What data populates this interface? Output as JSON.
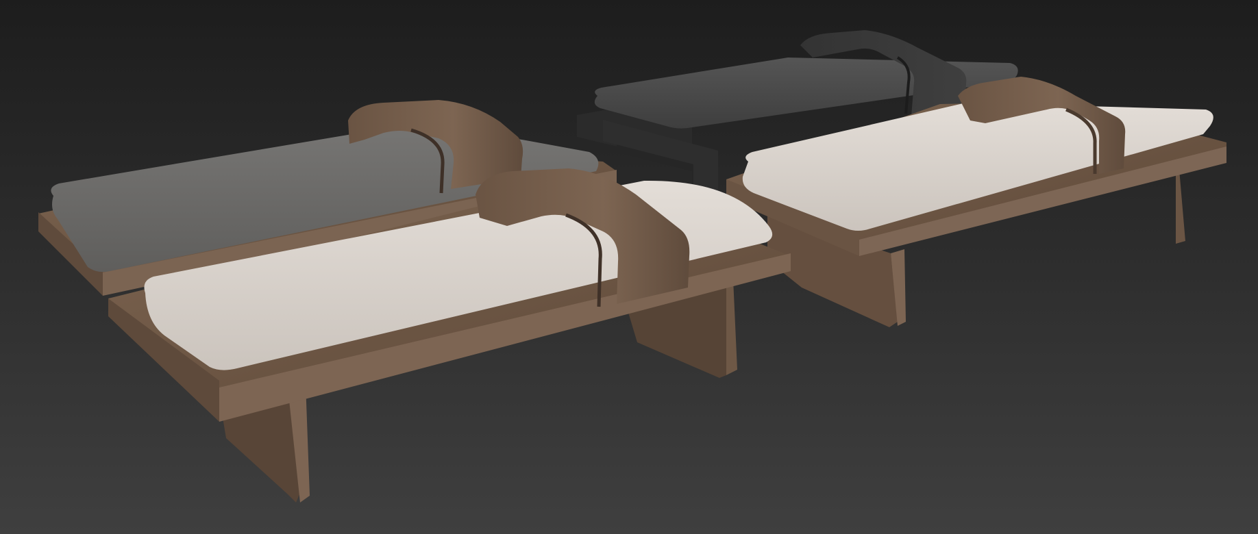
{
  "scene": {
    "subject": "render",
    "background": {
      "top": "#1d1d1d",
      "bottom": "#3f3f3f"
    },
    "benches": [
      {
        "id": "grey-cushion-bench",
        "cushion_color": "#6c6b69",
        "frame_color": "#6b5543",
        "band_color": "#6d5644"
      },
      {
        "id": "light-cushion-bench-front",
        "cushion_color": "#d7d1cb",
        "frame_color": "#6a5444",
        "band_color": "#705847"
      },
      {
        "id": "dark-cushion-bench",
        "cushion_color": "#4a4a4a",
        "frame_color": "#2a2a2a",
        "band_color": "#3a3a3a"
      },
      {
        "id": "light-cushion-bench-right",
        "cushion_color": "#d8d3cd",
        "frame_color": "#7a6452",
        "band_color": "#7b6350"
      }
    ]
  }
}
